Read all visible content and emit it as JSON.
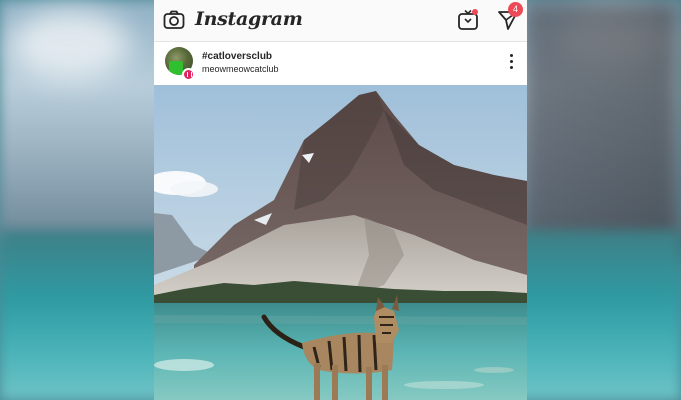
{
  "app": {
    "brand": "Instagram",
    "direct_badge_count": "4"
  },
  "icons": {
    "camera": "camera-icon",
    "igtv": "igtv-icon",
    "direct": "paper-plane-icon",
    "more": "more-vertical-icon"
  },
  "post": {
    "title": "#catloversclub",
    "subtitle": "meowmeowcatclub",
    "image_subject": "cat-by-mountain-lake"
  },
  "colors": {
    "badge_red": "#ed4956",
    "text": "#262626",
    "lake": "#48b2b8"
  }
}
